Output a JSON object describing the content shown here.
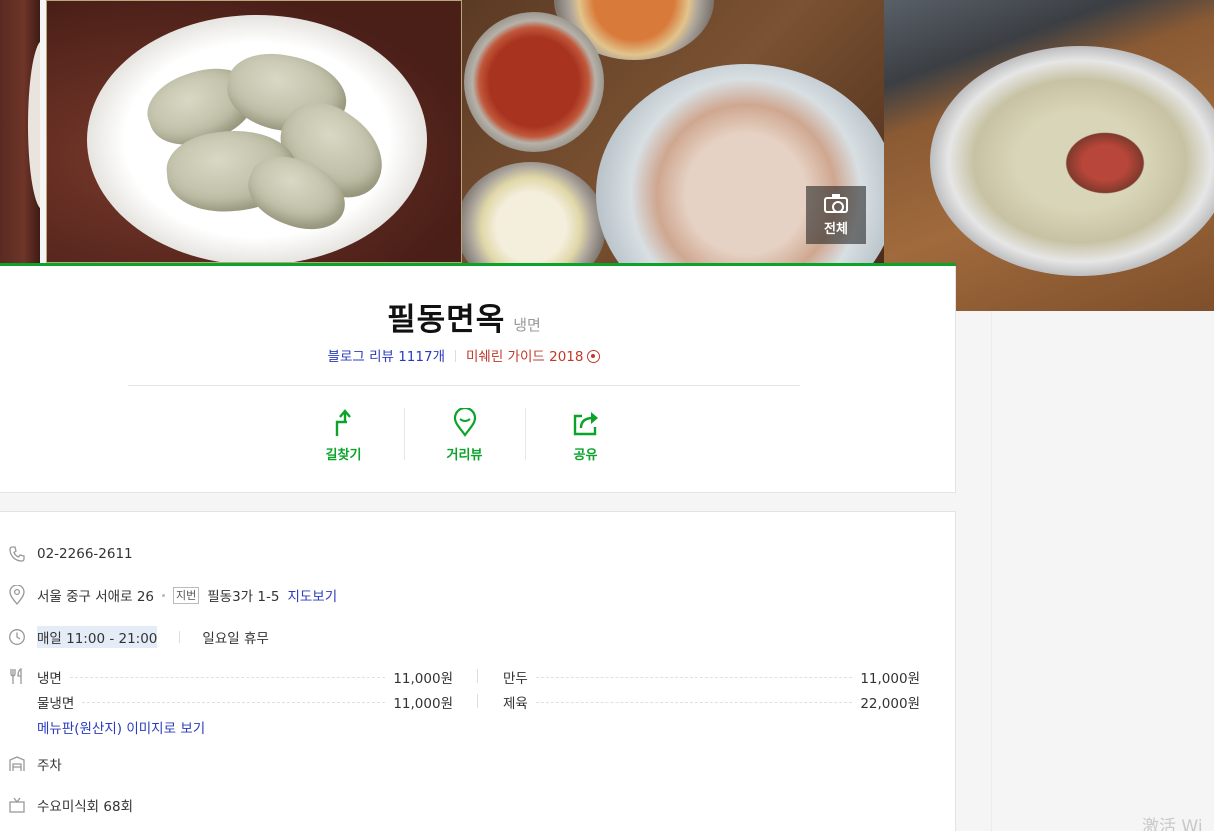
{
  "photos": {
    "all_photos_label": "전체"
  },
  "place": {
    "name": "필동면옥",
    "category": "냉면",
    "blog_review": "블로그 리뷰 1117개",
    "michelin": "미쉐린 가이드 2018"
  },
  "actions": [
    {
      "label": "길찾기",
      "icon": "directions-icon"
    },
    {
      "label": "거리뷰",
      "icon": "street-view-pin-icon"
    },
    {
      "label": "공유",
      "icon": "share-icon"
    }
  ],
  "info": {
    "phone": "02-2266-2611",
    "address": "서울 중구 서애로 26",
    "lot_tag": "지번",
    "lot_address": "필동3가 1-5",
    "map_link": "지도보기",
    "hours": "매일 11:00 - 21:00",
    "closed": "일요일 휴무",
    "menu": [
      {
        "name": "냉면",
        "price": "11,000원"
      },
      {
        "name": "만두",
        "price": "11,000원"
      },
      {
        "name": "물냉면",
        "price": "11,000원"
      },
      {
        "name": "제육",
        "price": "22,000원"
      }
    ],
    "menu_image_link": "메뉴판(원산지) 이미지로 보기",
    "parking": "주차",
    "tv": "수요미식회 68회"
  },
  "watermark": "激活 Wi",
  "colors": {
    "accent": "#0ba32a",
    "link": "#2a3bbf",
    "michelin": "#c0392b"
  }
}
